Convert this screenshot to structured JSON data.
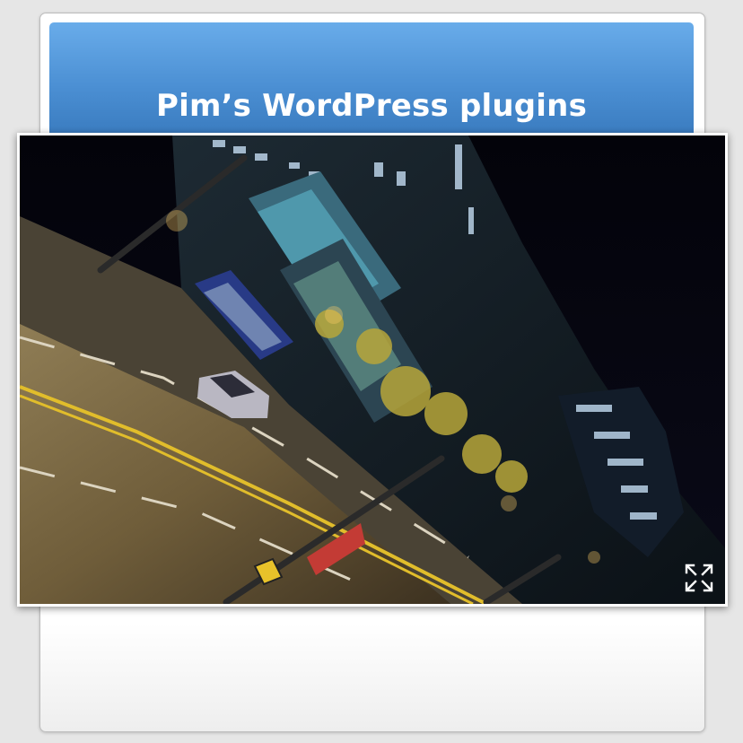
{
  "site": {
    "title": "Pim’s WordPress plugins"
  },
  "lightbox": {
    "photo_subject": "night-city-street",
    "fullscreen_icon": "expand-arrows-icon"
  },
  "colors": {
    "background": "#e6e6e6",
    "banner_top": "#69acea",
    "banner_bottom": "#2f6fb3",
    "title_text": "#ffffff",
    "night_sky": "#05050c"
  }
}
